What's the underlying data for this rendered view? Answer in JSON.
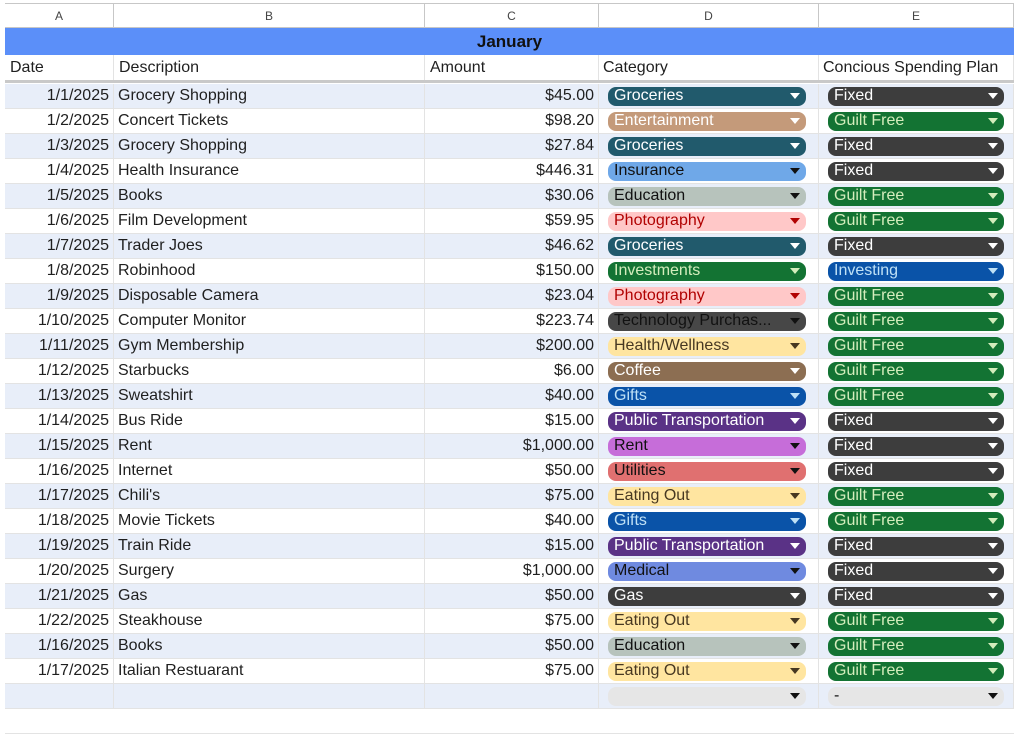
{
  "columns": [
    "A",
    "B",
    "C",
    "D",
    "E"
  ],
  "month_title": "January",
  "headers": {
    "date": "Date",
    "description": "Description",
    "amount": "Amount",
    "category": "Category",
    "plan": "Concious Spending Plan"
  },
  "category_colors": {
    "Groceries": {
      "bg": "#215a6c",
      "fg": "#ffffff"
    },
    "Entertainment": {
      "bg": "#c49a7a",
      "fg": "#ffffff"
    },
    "Insurance": {
      "bg": "#6fa8e8",
      "fg": "#111111"
    },
    "Education": {
      "bg": "#b7c3bc",
      "fg": "#111111"
    },
    "Photography": {
      "bg": "#ffc8c8",
      "fg": "#b10202"
    },
    "Investments": {
      "bg": "#137333",
      "fg": "#d4edbc"
    },
    "Technology Purchas...": {
      "bg": "#474747",
      "fg": "#111111"
    },
    "Health/Wellness": {
      "bg": "#ffe5a0",
      "fg": "#473822"
    },
    "Coffee": {
      "bg": "#8c6e52",
      "fg": "#ffffff"
    },
    "Gifts": {
      "bg": "#0a53a8",
      "fg": "#bfe1f6"
    },
    "Public Transportation": {
      "bg": "#5a3286",
      "fg": "#ffffff"
    },
    "Rent": {
      "bg": "#c66dd9",
      "fg": "#111111"
    },
    "Utilities": {
      "bg": "#e07070",
      "fg": "#111111"
    },
    "Eating Out": {
      "bg": "#ffe5a0",
      "fg": "#473822"
    },
    "Medical": {
      "bg": "#6f8ae0",
      "fg": "#111111"
    },
    "Gas": {
      "bg": "#3d3d3d",
      "fg": "#ffffff"
    }
  },
  "plan_colors": {
    "Fixed": {
      "bg": "#3d3d3d",
      "fg": "#ffffff"
    },
    "Guilt Free": {
      "bg": "#137333",
      "fg": "#d4edbc"
    },
    "Investing": {
      "bg": "#0a53a8",
      "fg": "#bfe1f6"
    }
  },
  "blank_plan_value": "-",
  "blank_chip_color": "#e6e6e6",
  "rows": [
    {
      "date": "1/1/2025",
      "description": "Grocery Shopping",
      "amount": "$45.00",
      "category": "Groceries",
      "plan": "Fixed"
    },
    {
      "date": "1/2/2025",
      "description": "Concert Tickets",
      "amount": "$98.20",
      "category": "Entertainment",
      "plan": "Guilt Free"
    },
    {
      "date": "1/3/2025",
      "description": "Grocery Shopping",
      "amount": "$27.84",
      "category": "Groceries",
      "plan": "Fixed"
    },
    {
      "date": "1/4/2025",
      "description": "Health Insurance",
      "amount": "$446.31",
      "category": "Insurance",
      "plan": "Fixed"
    },
    {
      "date": "1/5/2025",
      "description": "Books",
      "amount": "$30.06",
      "category": "Education",
      "plan": "Guilt Free"
    },
    {
      "date": "1/6/2025",
      "description": "Film Development",
      "amount": "$59.95",
      "category": "Photography",
      "plan": "Guilt Free"
    },
    {
      "date": "1/7/2025",
      "description": "Trader Joes",
      "amount": "$46.62",
      "category": "Groceries",
      "plan": "Fixed"
    },
    {
      "date": "1/8/2025",
      "description": "Robinhood",
      "amount": "$150.00",
      "category": "Investments",
      "plan": "Investing"
    },
    {
      "date": "1/9/2025",
      "description": "Disposable Camera",
      "amount": "$23.04",
      "category": "Photography",
      "plan": "Guilt Free"
    },
    {
      "date": "1/10/2025",
      "description": "Computer Monitor",
      "amount": "$223.74",
      "category": "Technology Purchas...",
      "plan": "Guilt Free"
    },
    {
      "date": "1/11/2025",
      "description": "Gym Membership",
      "amount": "$200.00",
      "category": "Health/Wellness",
      "plan": "Guilt Free"
    },
    {
      "date": "1/12/2025",
      "description": "Starbucks",
      "amount": "$6.00",
      "category": "Coffee",
      "plan": "Guilt Free"
    },
    {
      "date": "1/13/2025",
      "description": "Sweatshirt",
      "amount": "$40.00",
      "category": "Gifts",
      "plan": "Guilt Free"
    },
    {
      "date": "1/14/2025",
      "description": "Bus Ride",
      "amount": "$15.00",
      "category": "Public Transportation",
      "plan": "Fixed"
    },
    {
      "date": "1/15/2025",
      "description": "Rent",
      "amount": "$1,000.00",
      "category": "Rent",
      "plan": "Fixed"
    },
    {
      "date": "1/16/2025",
      "description": "Internet",
      "amount": "$50.00",
      "category": "Utilities",
      "plan": "Fixed"
    },
    {
      "date": "1/17/2025",
      "description": "Chili's",
      "amount": "$75.00",
      "category": "Eating Out",
      "plan": "Guilt Free"
    },
    {
      "date": "1/18/2025",
      "description": "Movie Tickets",
      "amount": "$40.00",
      "category": "Gifts",
      "plan": "Guilt Free"
    },
    {
      "date": "1/19/2025",
      "description": "Train Ride",
      "amount": "$15.00",
      "category": "Public Transportation",
      "plan": "Fixed"
    },
    {
      "date": "1/20/2025",
      "description": "Surgery",
      "amount": "$1,000.00",
      "category": "Medical",
      "plan": "Fixed"
    },
    {
      "date": "1/21/2025",
      "description": "Gas",
      "amount": "$50.00",
      "category": "Gas",
      "plan": "Fixed"
    },
    {
      "date": "1/22/2025",
      "description": "Steakhouse",
      "amount": "$75.00",
      "category": "Eating Out",
      "plan": "Guilt Free"
    },
    {
      "date": "1/16/2025",
      "description": "Books",
      "amount": "$50.00",
      "category": "Education",
      "plan": "Guilt Free"
    },
    {
      "date": "1/17/2025",
      "description": "Italian Restuarant",
      "amount": "$75.00",
      "category": "Eating Out",
      "plan": "Guilt Free"
    }
  ]
}
